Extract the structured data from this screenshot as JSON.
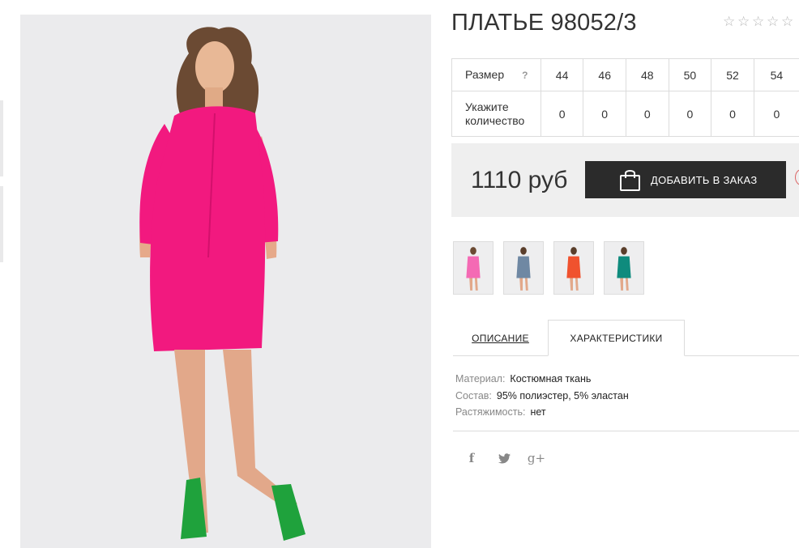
{
  "product": {
    "title": "ПЛАТЬЕ 98052/3",
    "rating_stars": [
      "☆",
      "☆",
      "☆",
      "☆",
      "☆"
    ]
  },
  "size_table": {
    "size_label": "Размер",
    "help_icon": "?",
    "qty_label_line1": "Укажите",
    "qty_label_line2": "количество",
    "sizes": [
      "44",
      "46",
      "48",
      "50",
      "52",
      "54"
    ],
    "quantities": [
      "0",
      "0",
      "0",
      "0",
      "0",
      "0"
    ]
  },
  "price": {
    "value": "1110 руб",
    "add_button": "ДОБАВИТЬ В ЗАКАЗ"
  },
  "color_thumbs": [
    {
      "name": "pink",
      "color": "#f46ab4"
    },
    {
      "name": "grey-blue",
      "color": "#6f88a3"
    },
    {
      "name": "coral",
      "color": "#f0522e"
    },
    {
      "name": "teal",
      "color": "#0f8b7d"
    }
  ],
  "tabs": {
    "description": "ОПИСАНИЕ",
    "characteristics": "ХАРАКТЕРИСТИКИ"
  },
  "characteristics": [
    {
      "key": "Материал:",
      "value": "Костюмная ткань"
    },
    {
      "key": "Состав:",
      "value": "95% полиэстер, 5% эластан"
    },
    {
      "key": "Растяжимость:",
      "value": "нет"
    }
  ],
  "social": {
    "facebook": "f",
    "twitter": "🐦",
    "googleplus": "g+"
  },
  "colors": {
    "dress": "#f2197f",
    "button_bg": "#2b2b2b",
    "panel_bg": "#efefef",
    "photo_bg": "#eaeaec"
  }
}
